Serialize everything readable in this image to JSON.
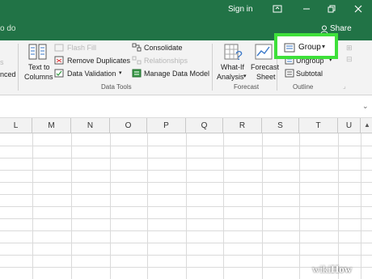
{
  "titlebar": {
    "signin": "Sign in"
  },
  "tabs": {
    "tell_me": "o do",
    "share": "Share"
  },
  "ribbon": {
    "text_to_columns_1": "Text to",
    "text_to_columns_2": "Columns",
    "left_cut": "nced",
    "flash_fill": "Flash Fill",
    "remove_duplicates": "Remove Duplicates",
    "data_validation": "Data Validation",
    "consolidate": "Consolidate",
    "relationships": "Relationships",
    "manage_data_model": "Manage Data Model",
    "data_tools_label": "Data Tools",
    "what_if_1": "What-If",
    "what_if_2": "Analysis",
    "forecast_1": "Forecast",
    "forecast_2": "Sheet",
    "forecast_label": "Forecast",
    "group": "Group",
    "ungroup": "Ungroup",
    "subtotal": "Subtotal",
    "outline_label": "Outline"
  },
  "columns": [
    "L",
    "M",
    "N",
    "O",
    "P",
    "Q",
    "R",
    "S",
    "T",
    "U"
  ],
  "watermark": {
    "wiki": "wiki",
    "how": "How"
  },
  "colors": {
    "excel_green": "#217346",
    "highlight": "#3ee03a"
  }
}
